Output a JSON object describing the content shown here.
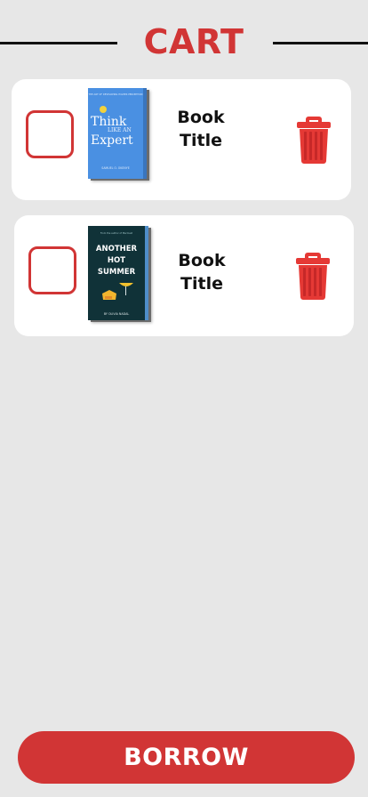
{
  "header": {
    "title": "CART"
  },
  "cart": {
    "items": [
      {
        "title_line1": "Book",
        "title_line2": "Title",
        "cover": {
          "text_top": "THE ART OF DEVELOPING HIGHER PERCEPTION",
          "text_title1": "Think",
          "text_title2": "LIKE AN",
          "text_title3": "Expert",
          "text_author": "SAMUEL O. OKENYE",
          "color": "#4a90e2"
        }
      },
      {
        "title_line1": "Book",
        "title_line2": "Title",
        "cover": {
          "text_top": "From the author of Mermaid",
          "text_title1": "ANOTHER",
          "text_title2": "HOT",
          "text_title3": "SUMMER",
          "text_author": "BY OLIVIA NADAL",
          "color": "#103238"
        }
      }
    ]
  },
  "footer": {
    "borrow_label": "BORROW"
  },
  "colors": {
    "accent": "#d13535",
    "background": "#e7e7e7",
    "card": "#ffffff"
  },
  "icons": {
    "delete": "trash-icon"
  }
}
